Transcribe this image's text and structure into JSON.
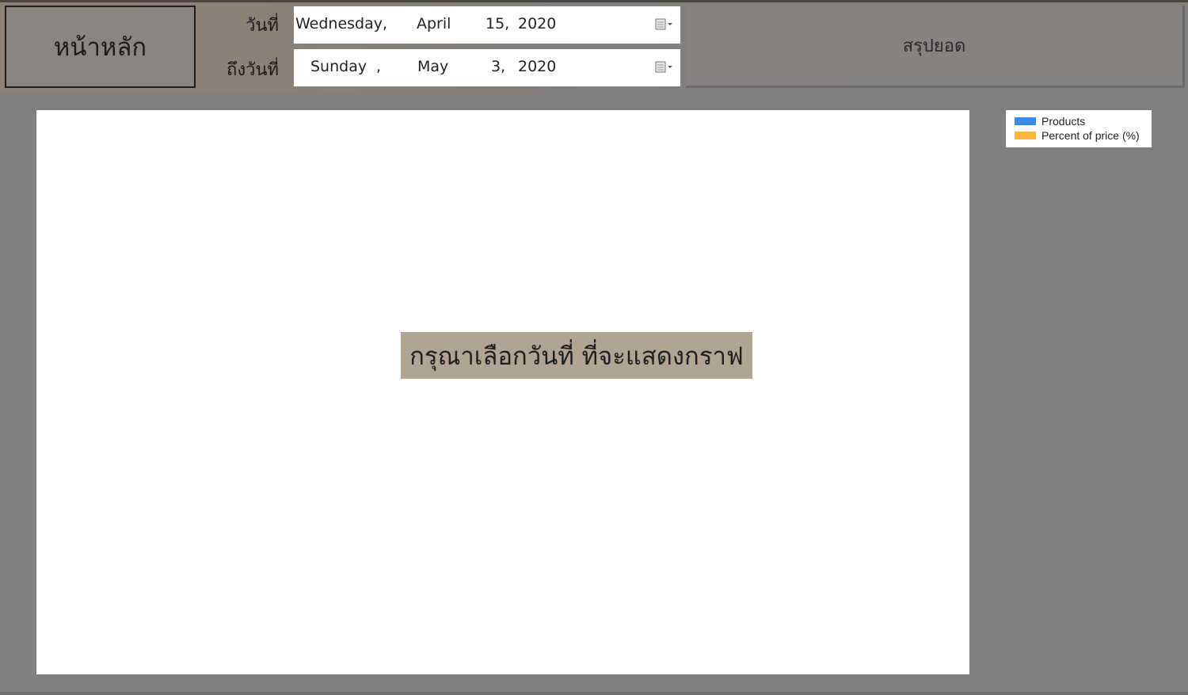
{
  "header": {
    "home_label": "หน้าหลัก",
    "from_label": "วันที่",
    "to_label": "ถึงวันที่",
    "summary_label": "สรุปยอด"
  },
  "date_from": {
    "weekday": "Wednesday,",
    "month": "April",
    "day": "15,",
    "year": "2020"
  },
  "date_to": {
    "weekday": "Sunday",
    "comma": ",",
    "month": "May",
    "day": "3,",
    "year": "2020"
  },
  "chart": {
    "prompt": "กรุณาเลือกวันที่  ที่จะแสดงกราฟ"
  },
  "legend": {
    "items": [
      {
        "label": "Products",
        "color": "#3b8beb"
      },
      {
        "label": "Percent of price (%)",
        "color": "#ffb340"
      }
    ]
  },
  "icons": {
    "calendar": "calendar-dropdown-icon"
  }
}
